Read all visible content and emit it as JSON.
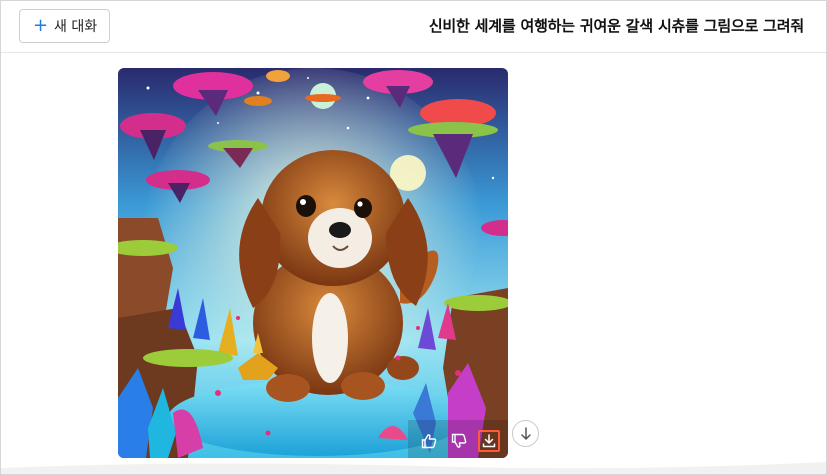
{
  "header": {
    "new_chat_label": "새 대화",
    "new_chat_icon": "plus-icon",
    "title": "신비한 세계를 여행하는 귀여운 갈색 시츄를 그림으로 그려줘"
  },
  "image": {
    "actions": [
      {
        "icon": "thumbs-up-icon"
      },
      {
        "icon": "thumbs-down-icon"
      },
      {
        "icon": "download-icon",
        "highlighted": true
      }
    ]
  },
  "scroll_down_icon": "arrow-down-icon",
  "colors": {
    "accent": "#1f7ae0",
    "highlight": "#ff5a3c"
  }
}
